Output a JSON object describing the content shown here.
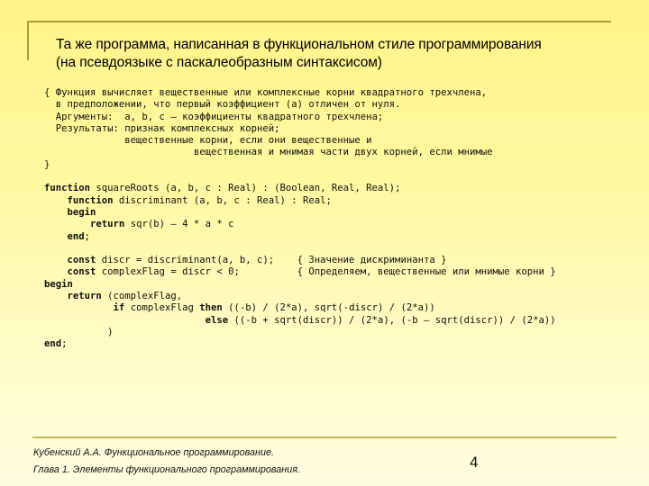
{
  "slide": {
    "title_lines": [
      "Та же программа, написанная в функциональном стиле программирования",
      "(на псевдоязыке с паскалеобразным синтаксисом)"
    ],
    "code_lines": [
      [
        {
          "t": "{ Функция вычисляет вещественные или комплексные корни квадратного трехчлена,"
        }
      ],
      [
        {
          "t": "  в предположении, что первый коэффициент (a) отличен от нуля."
        }
      ],
      [
        {
          "t": "  Аргументы:  a, b, c – коэффициенты квадратного трехчлена;"
        }
      ],
      [
        {
          "t": "  Результаты: признак комплексных корней;"
        }
      ],
      [
        {
          "t": "              вещественные корни, если они вещественные и"
        }
      ],
      [
        {
          "t": "                          вещественная и мнимая части двух корней, если мнимые"
        }
      ],
      [
        {
          "t": "}"
        }
      ],
      [
        {
          "t": ""
        }
      ],
      [
        {
          "t": "function",
          "kw": true
        },
        {
          "t": " squareRoots (a, b, c : Real) : (Boolean, Real, Real);"
        }
      ],
      [
        {
          "t": "    "
        },
        {
          "t": "function",
          "kw": true
        },
        {
          "t": " discriminant (a, b, c : Real) : Real;"
        }
      ],
      [
        {
          "t": "    "
        },
        {
          "t": "begin",
          "kw": true
        }
      ],
      [
        {
          "t": "        "
        },
        {
          "t": "return",
          "kw": true
        },
        {
          "t": " sqr(b) – 4 * a * c"
        }
      ],
      [
        {
          "t": "    "
        },
        {
          "t": "end",
          "kw": true
        },
        {
          "t": ";"
        }
      ],
      [
        {
          "t": ""
        }
      ],
      [
        {
          "t": "    "
        },
        {
          "t": "const",
          "kw": true
        },
        {
          "t": " discr = discriminant(a, b, c);    { Значение дискриминанта }"
        }
      ],
      [
        {
          "t": "    "
        },
        {
          "t": "const",
          "kw": true
        },
        {
          "t": " complexFlag = discr < 0;          { Определяем, вещественные или мнимые корни }"
        }
      ],
      [
        {
          "t": "begin",
          "kw": true
        }
      ],
      [
        {
          "t": "    "
        },
        {
          "t": "return",
          "kw": true
        },
        {
          "t": " (complexFlag,"
        }
      ],
      [
        {
          "t": "            "
        },
        {
          "t": "if",
          "kw": true
        },
        {
          "t": " complexFlag "
        },
        {
          "t": "then",
          "kw": true
        },
        {
          "t": " ((-b) / (2*a), sqrt(-discr) / (2*a))"
        }
      ],
      [
        {
          "t": "                            "
        },
        {
          "t": "else",
          "kw": true
        },
        {
          "t": " ((-b + sqrt(discr)) / (2*a), (-b – sqrt(discr)) / (2*a))"
        }
      ],
      [
        {
          "t": "           )"
        }
      ],
      [
        {
          "t": "end",
          "kw": true
        },
        {
          "t": ";"
        }
      ]
    ],
    "footer": {
      "line1": "Кубенский А.А. Функциональное программирование.",
      "line2": "Глава 1. Элементы функционального программирования."
    },
    "page_number": "4"
  },
  "colors": {
    "rule": "#a8a030",
    "background_top": "#fff488",
    "background_bottom": "#fffde0"
  }
}
